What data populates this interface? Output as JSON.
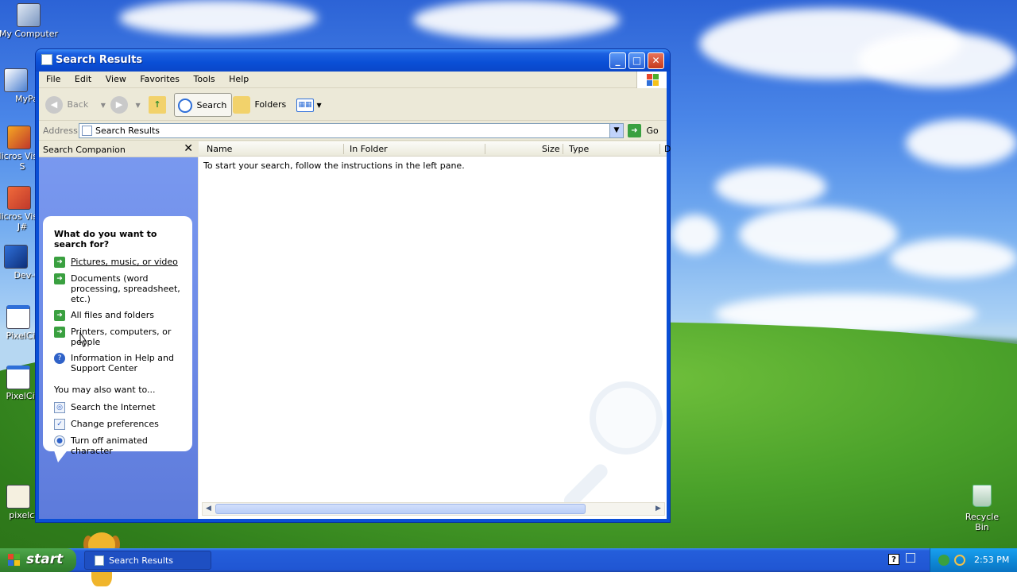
{
  "desktop": {
    "icons": [
      {
        "label": "My Computer"
      },
      {
        "label": "MyPal"
      },
      {
        "label": "Micros Visual S"
      },
      {
        "label": "Micros Visual J#"
      },
      {
        "label": "Dev-C"
      },
      {
        "label": "PixelCity"
      },
      {
        "label": "PixelCity"
      },
      {
        "label": "pixelcit"
      }
    ],
    "recycle_bin": "Recycle Bin"
  },
  "window": {
    "title": "Search Results",
    "controls": {
      "minimize": "_",
      "maximize": "□",
      "close": "✕"
    },
    "menu": [
      "File",
      "Edit",
      "View",
      "Favorites",
      "Tools",
      "Help"
    ],
    "toolbar": {
      "back": "Back",
      "search": "Search",
      "folders": "Folders"
    },
    "address": {
      "label": "Address",
      "value": "Search Results",
      "go": "Go"
    },
    "search_companion": {
      "header": "Search Companion",
      "close": "✕",
      "question": "What do you want to search for?",
      "options": [
        "Pictures, music, or video",
        "Documents (word processing, spreadsheet, etc.)",
        "All files and folders",
        "Printers, computers, or people",
        "Information in Help and Support Center"
      ],
      "also_label": "You may also want to...",
      "also_options": [
        "Search the Internet",
        "Change preferences",
        "Turn off animated character"
      ]
    },
    "results": {
      "columns": [
        "Name",
        "In Folder",
        "Size",
        "Type",
        "D"
      ],
      "message": "To start your search, follow the instructions in the left pane."
    }
  },
  "taskbar": {
    "start": "start",
    "items": [
      "Search Results"
    ],
    "clock": "2:53 PM",
    "tray_help": "?"
  },
  "colors": {
    "titlebar": "#0a4fd6",
    "start_green": "#3a8d36",
    "taskbar_blue": "#245edb",
    "companion_blue": "#7a9af0"
  }
}
